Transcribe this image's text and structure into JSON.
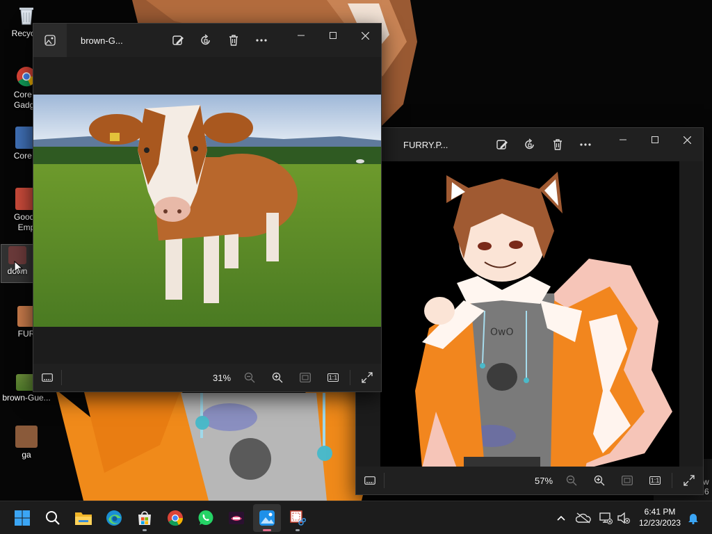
{
  "desktop": {
    "icons": [
      {
        "label": "Recycle",
        "icon": "recycle-bin-icon"
      },
      {
        "label": "Core T Gadge",
        "icon": "chrome-shortcut-icon"
      },
      {
        "label": "Core T",
        "icon": "shortcut-icon"
      },
      {
        "label": "Goodg Emp",
        "icon": "shortcut-icon"
      },
      {
        "label": "down",
        "icon": "image-thumbnail-icon"
      },
      {
        "label": "FUR",
        "icon": "image-thumbnail-icon"
      },
      {
        "label": "brown-Gue...",
        "icon": "image-thumbnail-icon"
      },
      {
        "label": "ga",
        "icon": "image-thumbnail-icon"
      }
    ],
    "wallpaper_edge_text": [
      "w",
      "6"
    ]
  },
  "window_cow": {
    "title": "brown-G...",
    "zoom": "31%",
    "actual_size_label": "1:1",
    "toolbar": [
      "edit-image-icon",
      "rotate-icon",
      "delete-icon",
      "more-icon"
    ]
  },
  "window_furry": {
    "title": "FURRY.P...",
    "zoom": "57%",
    "actual_size_label": "1:1",
    "hoodie_text": "OwO"
  },
  "taskbar": {
    "apps": [
      "start",
      "search",
      "file-explorer",
      "edge",
      "microsoft-store",
      "chrome",
      "whatsapp",
      "game-app",
      "photos",
      "snipping-tool"
    ],
    "active_app": "photos",
    "clock": {
      "time": "6:41 PM",
      "date": "12/23/2023"
    }
  },
  "colors": {
    "taskbar_bg": "#1c1c1c",
    "window_bg": "#202020",
    "photos_accent": "#1e90e8",
    "hoodie_orange": "#f2861e"
  }
}
